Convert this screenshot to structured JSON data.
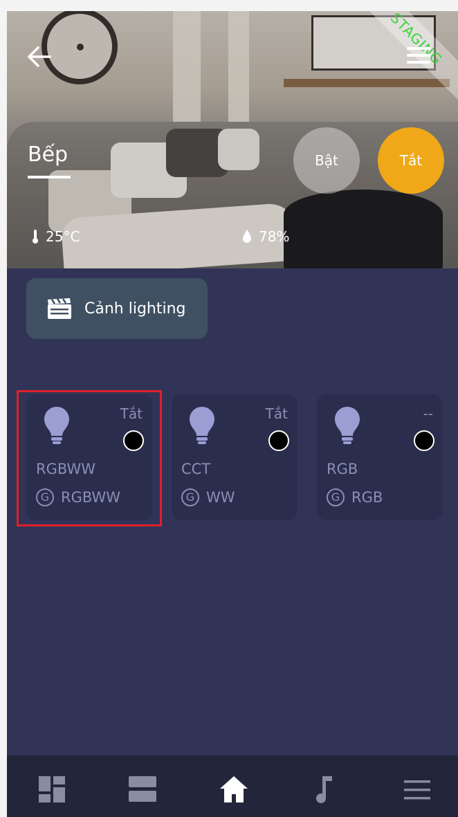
{
  "header": {
    "room_title": "Bếp",
    "staging_label": "STAGING",
    "btn_on_label": "Bật",
    "btn_off_label": "Tắt",
    "temperature": "25°C",
    "humidity": "78%"
  },
  "scene": {
    "label": "Cảnh lighting",
    "icon": "clapperboard-icon"
  },
  "devices": [
    {
      "state": "Tắt",
      "name": "RGBWW",
      "group_icon": "G",
      "type": "RGBWW"
    },
    {
      "state": "Tắt",
      "name": "CCT",
      "group_icon": "G",
      "type": "WW"
    },
    {
      "state": "--",
      "name": "RGB",
      "group_icon": "G",
      "type": "RGB"
    }
  ],
  "nav": {
    "items": [
      "dashboard-icon",
      "list-icon",
      "home-icon",
      "music-icon",
      "menu-icon"
    ],
    "active": "home-icon"
  },
  "colors": {
    "background": "#313456",
    "card": "#2a2d4c",
    "accent": "#f0a818",
    "highlight": "#e1202b",
    "staging": "#3dd13d"
  }
}
